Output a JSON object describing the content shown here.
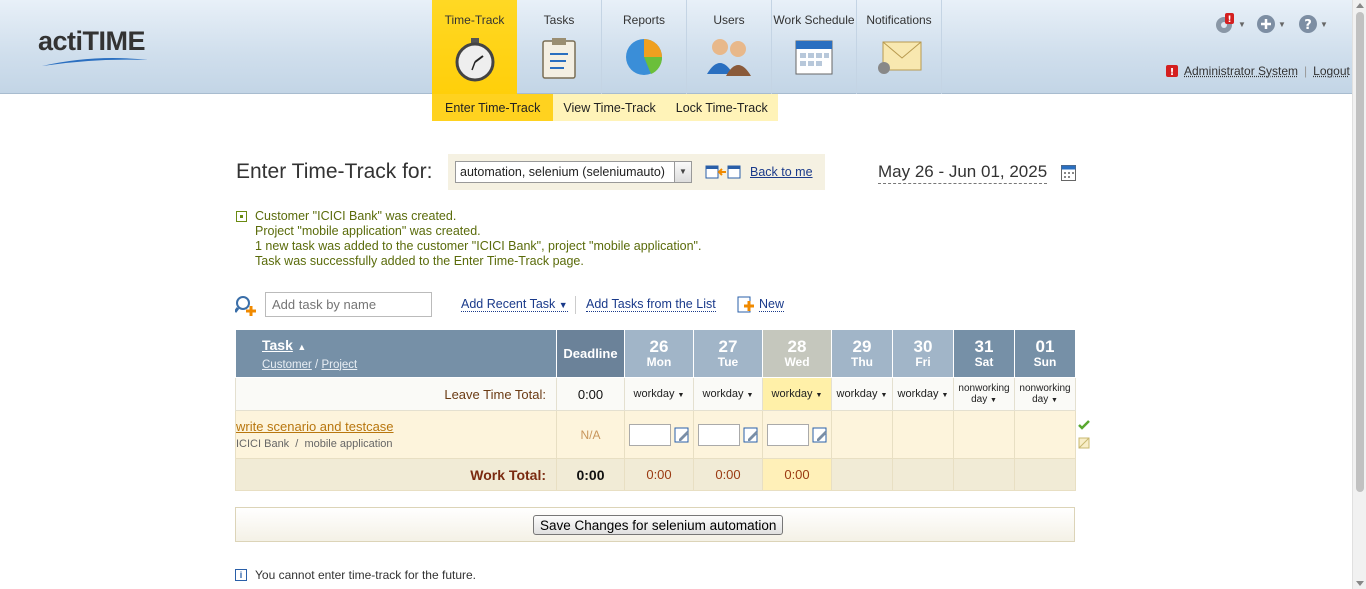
{
  "app": {
    "logo": "actiTIME"
  },
  "nav": {
    "items": [
      {
        "label": "Time-Track",
        "icon": "stopwatch-icon",
        "active": true
      },
      {
        "label": "Tasks",
        "icon": "clipboard-icon"
      },
      {
        "label": "Reports",
        "icon": "pie-chart-icon"
      },
      {
        "label": "Users",
        "icon": "users-icon"
      },
      {
        "label": "Work Schedule",
        "icon": "calendar-icon"
      },
      {
        "label": "Notifications",
        "icon": "envelope-icon"
      }
    ],
    "sub": [
      {
        "label": "Enter Time-Track",
        "selected": true
      },
      {
        "label": "View Time-Track"
      },
      {
        "label": "Lock Time-Track"
      }
    ]
  },
  "header_right": {
    "user": "Administrator System",
    "logout": "Logout"
  },
  "page": {
    "title": "Enter Time-Track for:",
    "user_select_value": "automation, selenium (seleniumauto)",
    "back_link": "Back to me",
    "date_range": "May 26 - Jun 01, 2025"
  },
  "messages": [
    "Customer \"ICICI Bank\" was created.",
    "Project \"mobile application\" was created.",
    "1 new task was added to the customer \"ICICI Bank\", project \"mobile application\".",
    "Task was successfully added to the Enter Time-Track page."
  ],
  "add_task": {
    "placeholder": "Add task by name",
    "recent": "Add Recent Task",
    "from_list": "Add Tasks from the List",
    "new": "New"
  },
  "grid": {
    "task_col": "Task",
    "customer_label": "Customer",
    "project_label": "Project",
    "deadline_col": "Deadline",
    "days": [
      {
        "num": "26",
        "name": "Mon",
        "status": "workday"
      },
      {
        "num": "27",
        "name": "Tue",
        "status": "workday"
      },
      {
        "num": "28",
        "name": "Wed",
        "status": "workday",
        "today": true
      },
      {
        "num": "29",
        "name": "Thu",
        "status": "workday"
      },
      {
        "num": "30",
        "name": "Fri",
        "status": "workday"
      },
      {
        "num": "31",
        "name": "Sat",
        "status": "nonworking day"
      },
      {
        "num": "01",
        "name": "Sun",
        "status": "nonworking day"
      }
    ],
    "leave_total_label": "Leave Time Total:",
    "leave_total_value": "0:00",
    "task": {
      "name": "write scenario and testcase",
      "customer": "ICICI Bank",
      "project": "mobile application",
      "deadline": "N/A"
    },
    "work_total_label": "Work Total:",
    "work_total_value": "0:00",
    "day_totals": [
      "0:00",
      "0:00",
      "0:00"
    ]
  },
  "save_button": "Save Changes for selenium automation",
  "info_text": "You cannot enter time-track for the future.",
  "colors": {
    "accent": "#ffd21f",
    "header_bg": "#cfdeec",
    "grid_header": "#7690a7"
  }
}
